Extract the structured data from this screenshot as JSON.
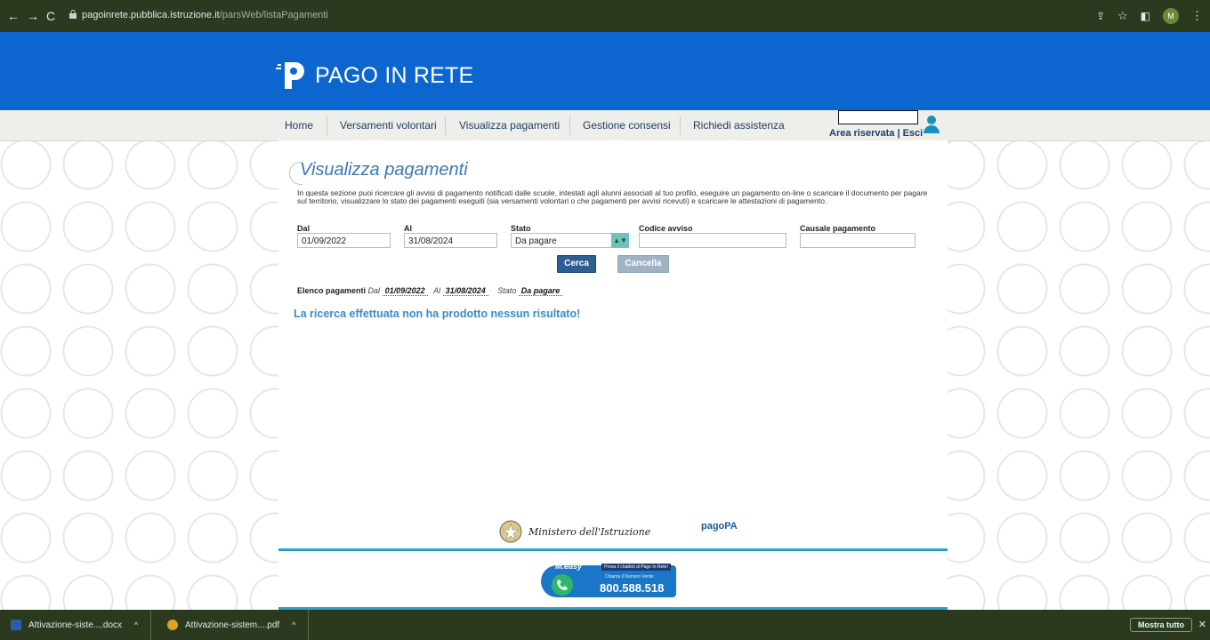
{
  "browser": {
    "url_host": "pagoinrete.pubblica.istruzione.it",
    "url_path": "/parsWeb/listaPagamenti",
    "profile_initial": "M"
  },
  "header": {
    "brand": "PAGO IN RETE",
    "brand_color": "#0d66d0"
  },
  "nav": {
    "items": [
      "Home",
      "Versamenti volontari",
      "Visualizza pagamenti",
      "Gestione consensi",
      "Richiedi assistenza"
    ],
    "area_riservata": "Area riservata",
    "separator": " | ",
    "esci": "Esci"
  },
  "page": {
    "title": "Visualizza pagamenti",
    "description": "In questa sezione puoi ricercare gli avvisi di pagamento notificati dalle scuole, intestati agli alunni associati al tuo profilo, eseguire un pagamento on-line o scaricare il documento per pagare sul territorio, visualizzare lo stato dei pagamenti eseguiti (sia versamenti volontari o che pagamenti per avvisi ricevuti) e scaricare le attestazioni di pagamento."
  },
  "form": {
    "dal_label": "Dal",
    "dal_value": "01/09/2022",
    "al_label": "Al",
    "al_value": "31/08/2024",
    "stato_label": "Stato",
    "stato_value": "Da pagare",
    "codice_label": "Codice avviso",
    "codice_value": "",
    "causale_label": "Causale pagamento",
    "causale_value": "",
    "cerca_label": "Cerca",
    "cancella_label": "Cancella"
  },
  "filters": {
    "elenco": "Elenco pagamenti",
    "dal": "Dal",
    "dal_value": "01/09/2022",
    "al": "Al",
    "al_value": "31/08/2024",
    "stato": "Stato",
    "stato_value": "Da pagare"
  },
  "result": {
    "message": "La ricerca effettuata non ha prodotto nessun risultato!"
  },
  "footer": {
    "ministry": "Ministero dell'Istruzione",
    "pagopa": "pagoPA",
    "meeasy": "M.easy",
    "meeasy_note": "Prova il chatbot di Pago In Rete!",
    "numero_label": "Chiama il Numero Verde:",
    "numero_verde": "800.588.518"
  },
  "downloads": {
    "file1": "Attivazione-siste....docx",
    "file2": "Attivazione-sistem....pdf",
    "show_all": "Mostra tutto"
  },
  "colors": {
    "accent": "#3a78b3",
    "result": "#3a8ac9",
    "cerca": "#2d5f93",
    "cancella": "#9fb3c3",
    "rule": "#28a0c7"
  }
}
